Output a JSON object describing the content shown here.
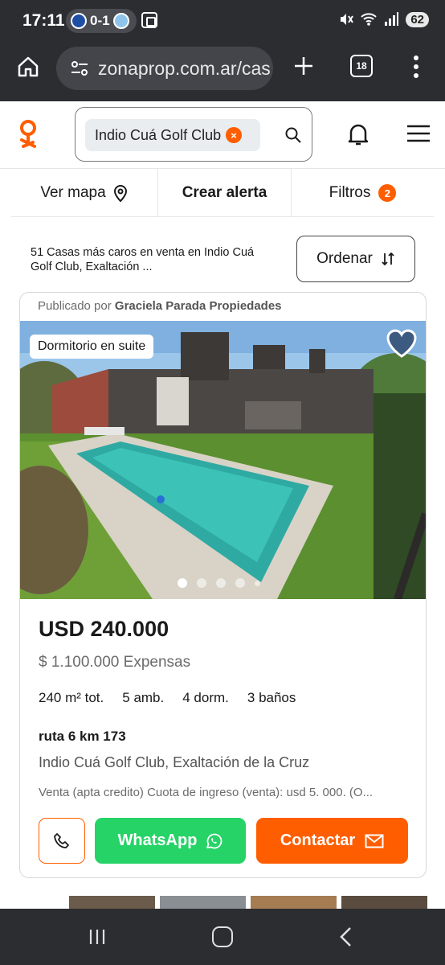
{
  "status_bar": {
    "time": "17:11",
    "score": "0-1",
    "battery": "62"
  },
  "browser": {
    "url": "zonaprop.com.ar/cas",
    "tab_count": "18"
  },
  "header": {
    "search_chip": "Indio Cuá Golf Club",
    "chip_close_symbol": "×"
  },
  "action_bar": {
    "map_label": "Ver mapa",
    "alert_label": "Crear alerta",
    "filters_label": "Filtros",
    "filters_count": "2"
  },
  "results": {
    "summary": "51 Casas más caros en venta en Indio Cuá Golf Club, Exaltación ...",
    "order_label": "Ordenar"
  },
  "listing": {
    "publisher_prefix": "Publicado por",
    "publisher_name": "Graciela Parada Propiedades",
    "photo_tag": "Dormitorio en suite",
    "price": "USD 240.000",
    "expensas": "$ 1.100.000 Expensas",
    "features": [
      "240 m² tot.",
      "5 amb.",
      "4 dorm.",
      "3 baños"
    ],
    "address": "ruta 6 km 173",
    "location": "Indio Cuá Golf Club, Exaltación de la Cruz",
    "description": "Venta (apta credito) Cuota de ingreso (venta): usd 5. 000. (O...",
    "whatsapp_label": "WhatsApp",
    "contact_label": "Contactar",
    "photo_index": 1,
    "photo_dots": 5
  },
  "colors": {
    "brand_orange": "#ff5e00",
    "whatsapp_green": "#25d366",
    "chrome_dark": "#2b2d31"
  }
}
